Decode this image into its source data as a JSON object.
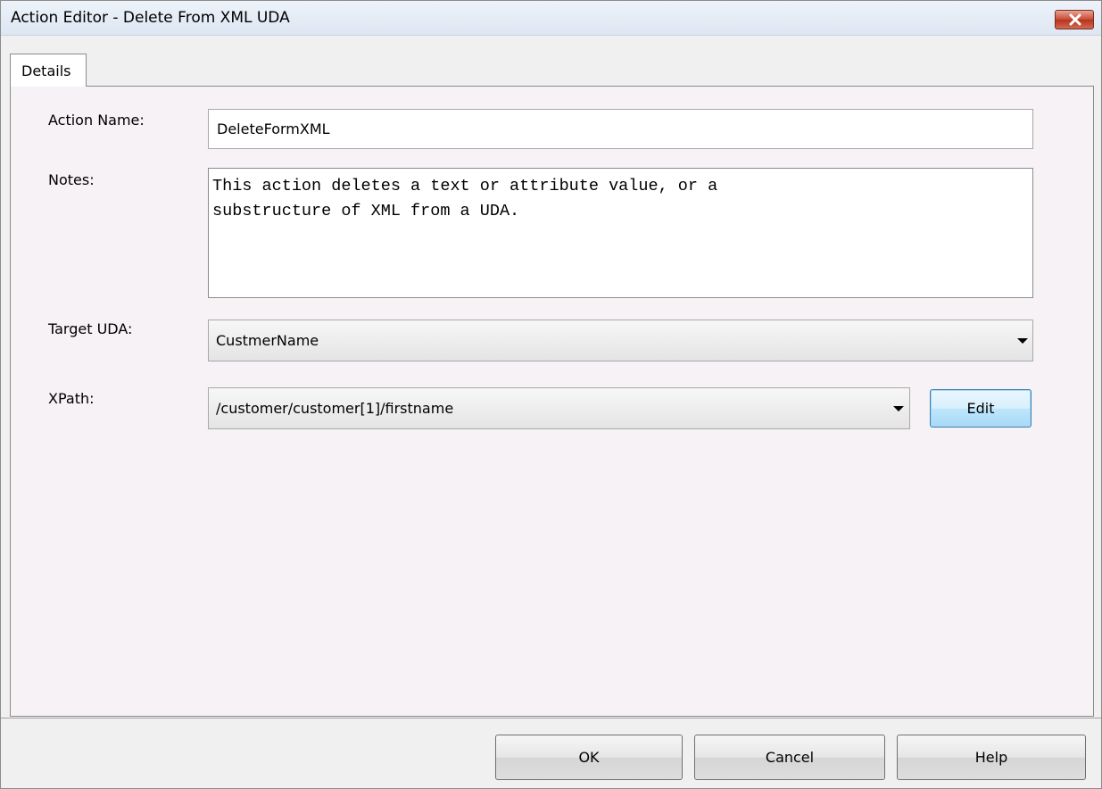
{
  "window": {
    "title": "Action Editor - Delete From XML UDA"
  },
  "tabs": [
    {
      "label": "Details"
    }
  ],
  "form": {
    "action_name_label": "Action Name:",
    "action_name_value": "DeleteFormXML",
    "notes_label": "Notes:",
    "notes_line1": "This action deletes a text or attribute value, or a",
    "notes_line2": "substructure of XML from a UDA.",
    "target_uda_label": "Target UDA:",
    "target_uda_value": "CustmerName",
    "xpath_label": "XPath:",
    "xpath_value": "/customer/customer[1]/firstname",
    "edit_label": "Edit"
  },
  "buttons": {
    "ok": "OK",
    "cancel": "Cancel",
    "help": "Help"
  },
  "colors": {
    "close_button": "#c74a34",
    "panel_bg": "#f6f2f6",
    "window_bg": "#f0f0f0"
  }
}
